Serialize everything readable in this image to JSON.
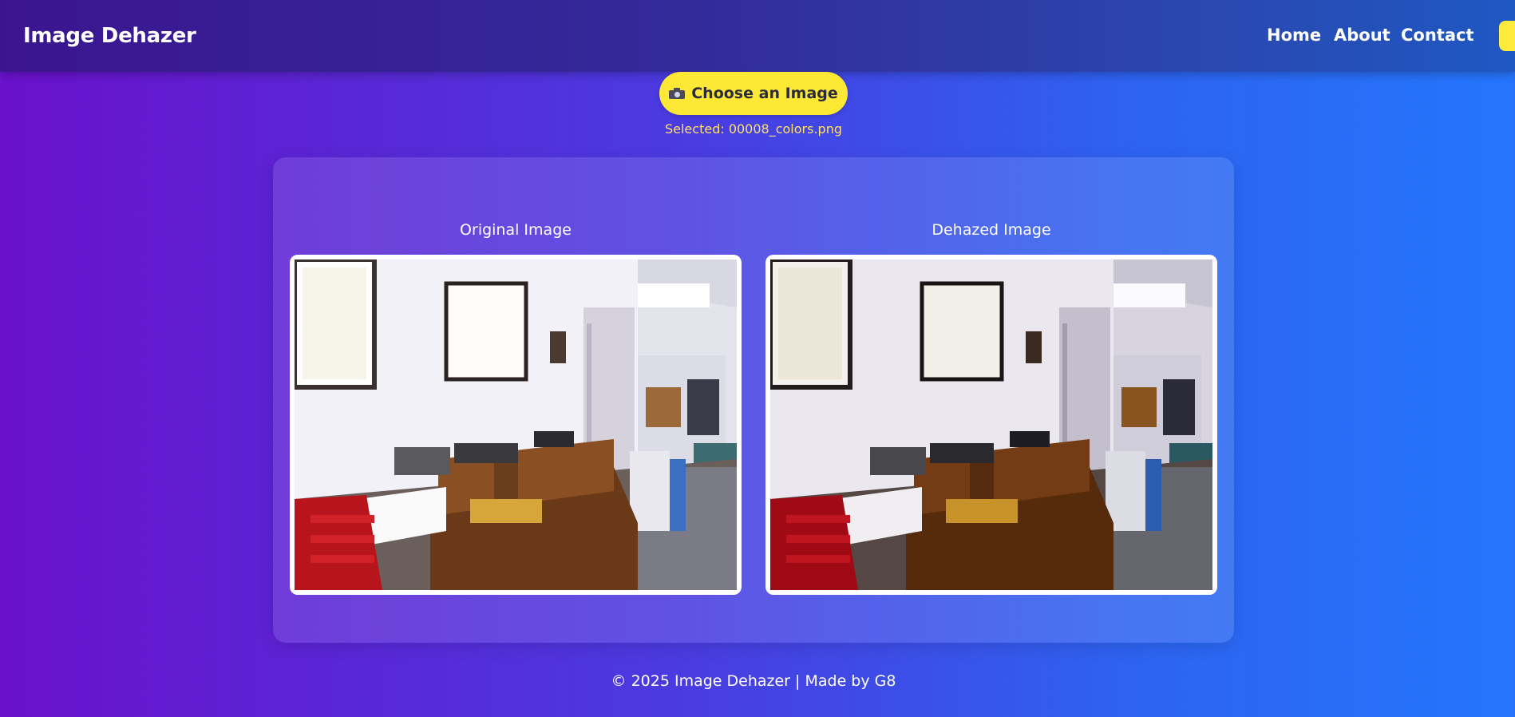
{
  "header": {
    "brand": "Image Dehazer",
    "nav": [
      {
        "label": "Home"
      },
      {
        "label": "About"
      },
      {
        "label": "Contact"
      }
    ]
  },
  "upload": {
    "button_label": "Choose an Image",
    "button_icon": "camera-icon",
    "selected_text": "Selected: 00008_colors.png"
  },
  "results": {
    "original_label": "Original Image",
    "dehazed_label": "Dehazed Image"
  },
  "footer": {
    "text": "© 2025 Image Dehazer | Made by G8"
  },
  "colors": {
    "accent": "#fde935",
    "selected_text": "#ffe066",
    "gradient_start": "#6a11cb",
    "gradient_end": "#2575fc"
  }
}
